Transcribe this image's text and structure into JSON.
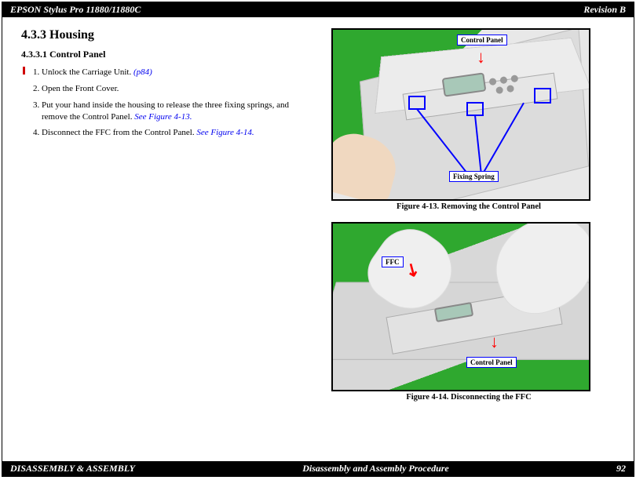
{
  "header": {
    "title_left": "EPSON Stylus Pro 11880/11880C",
    "title_right": "Revision B"
  },
  "footer": {
    "left": "DISASSEMBLY & ASSEMBLY",
    "center": "Disassembly and Assembly Procedure",
    "right": "92"
  },
  "section": {
    "number_title": "4.3.3  Housing",
    "sub_number_title": "4.3.3.1  Control Panel"
  },
  "steps": [
    {
      "text": "Unlock the Carriage Unit. ",
      "link": "(p84)"
    },
    {
      "text": "Open the Front Cover.",
      "link": ""
    },
    {
      "text": "Put your hand inside the housing to release the three fixing springs, and remove the Control Panel. ",
      "link": "See Figure 4-13."
    },
    {
      "text": "Disconnect the FFC from the Control Panel. ",
      "link": "See Figure 4-14."
    }
  ],
  "figure1": {
    "caption": "Figure 4-13.  Removing the Control Panel",
    "callout_top": "Control Panel",
    "callout_bottom": "Fixing Spring"
  },
  "figure2": {
    "caption": "Figure 4-14.  Disconnecting the FFC",
    "callout_left": "FFC",
    "callout_bottom": "Control Panel"
  }
}
